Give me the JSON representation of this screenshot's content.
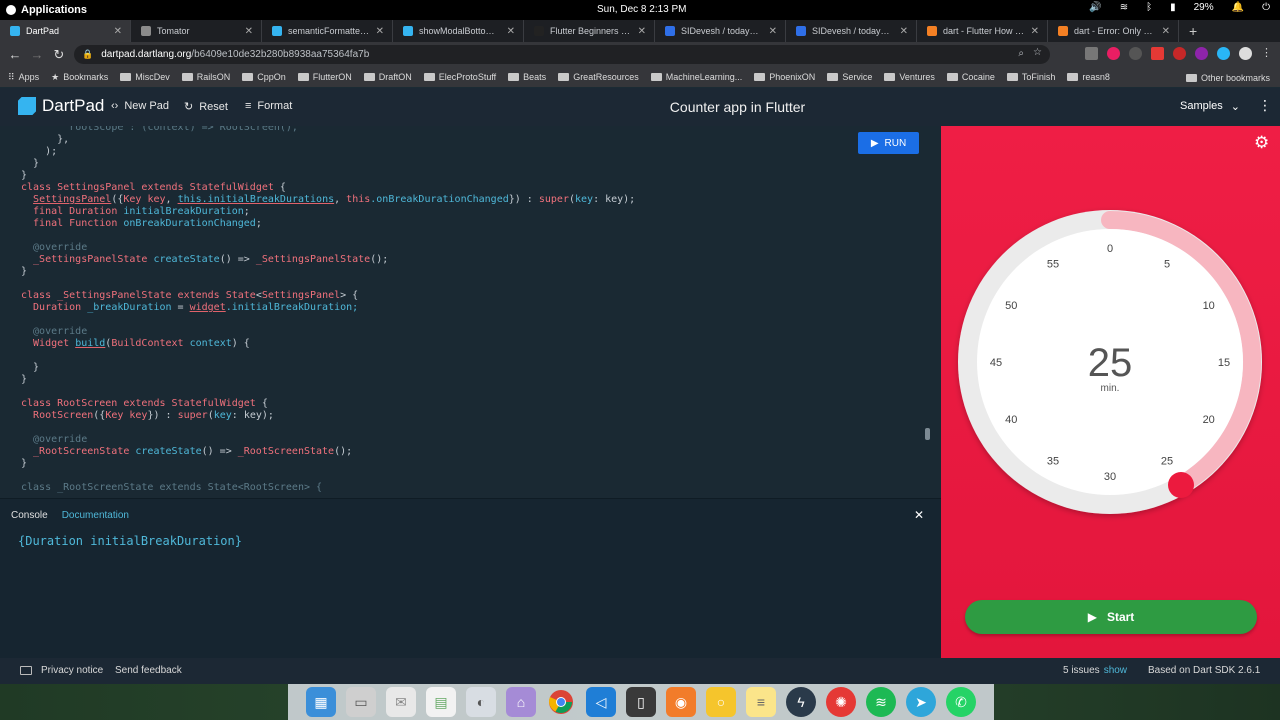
{
  "os": {
    "apps_label": "Applications",
    "clock": "Sun, Dec 8    2:13 PM",
    "battery": "29%"
  },
  "browser": {
    "tabs": [
      {
        "title": "DartPad",
        "color": "#35b4f0"
      },
      {
        "title": "Tomator",
        "color": "#8b8b8b"
      },
      {
        "title": "semanticFormatterCall",
        "color": "#35b4f0"
      },
      {
        "title": "showModalBottomShe",
        "color": "#35b4f0"
      },
      {
        "title": "Flutter Beginners Guide",
        "color": "#222222"
      },
      {
        "title": "SIDevesh / today_in_life",
        "color": "#2f6fe8"
      },
      {
        "title": "SIDevesh / today_in_life",
        "color": "#2f6fe8"
      },
      {
        "title": "dart - Flutter How to se",
        "color": "#f48024"
      },
      {
        "title": "dart - Error: Only static",
        "color": "#f48024"
      }
    ],
    "url_host": "dartpad.dartlang.org",
    "url_path": "/b6409e10de32b280b8938aa75364fa7b",
    "bookmarks": [
      {
        "label": "Apps",
        "kind": "apps"
      },
      {
        "label": "Bookmarks",
        "kind": "star"
      },
      {
        "label": "MiscDev",
        "kind": "folder"
      },
      {
        "label": "RailsON",
        "kind": "folder"
      },
      {
        "label": "CppOn",
        "kind": "folder"
      },
      {
        "label": "FlutterON",
        "kind": "folder"
      },
      {
        "label": "DraftON",
        "kind": "folder"
      },
      {
        "label": "ElecProtoStuff",
        "kind": "folder"
      },
      {
        "label": "Beats",
        "kind": "folder"
      },
      {
        "label": "GreatResources",
        "kind": "folder"
      },
      {
        "label": "MachineLearning...",
        "kind": "folder"
      },
      {
        "label": "PhoenixON",
        "kind": "folder"
      },
      {
        "label": "Service",
        "kind": "folder"
      },
      {
        "label": "Ventures",
        "kind": "folder"
      },
      {
        "label": "Cocaine",
        "kind": "folder"
      },
      {
        "label": "ToFinish",
        "kind": "folder"
      },
      {
        "label": "reasn8",
        "kind": "folder"
      }
    ],
    "other_bookmarks": "Other bookmarks"
  },
  "dartpad": {
    "logo": "DartPad",
    "new_pad": "New Pad",
    "reset": "Reset",
    "format": "Format",
    "title": "Counter app in Flutter",
    "samples": "Samples",
    "run": "RUN",
    "console_tab": "Console",
    "documentation_tab": "Documentation",
    "console_output": "{Duration initialBreakDuration}",
    "privacy": "Privacy notice",
    "feedback": "Send feedback",
    "issues": "5 issues",
    "issues_show": "show",
    "sdk": "Based on Dart SDK 2.6.1"
  },
  "timer": {
    "value": "25",
    "unit": "min.",
    "start_label": "Start",
    "dial_labels": [
      "0",
      "5",
      "10",
      "15",
      "20",
      "25",
      "30",
      "35",
      "40",
      "45",
      "50",
      "55"
    ],
    "progress_fraction": 0.4167,
    "accent": "#e3163c",
    "button_color": "#2e9b42"
  },
  "code_lines": [
    [
      {
        "t": "        ",
        "c": ""
      },
      {
        "t": "rootScope : (context) => RootScreen(),",
        "c": "an"
      }
    ],
    [
      {
        "t": "      },",
        "c": ""
      }
    ],
    [
      {
        "t": "    );",
        "c": ""
      }
    ],
    [
      {
        "t": "  }",
        "c": ""
      }
    ],
    [
      {
        "t": "}",
        "c": ""
      }
    ],
    [
      {
        "t": "class ",
        "c": "kw"
      },
      {
        "t": "SettingsPanel ",
        "c": "ty"
      },
      {
        "t": "extends ",
        "c": "kw"
      },
      {
        "t": "StatefulWidget",
        "c": "ty"
      },
      {
        "t": " {",
        "c": ""
      }
    ],
    [
      {
        "t": "  ",
        "c": ""
      },
      {
        "t": "SettingsPanel",
        "c": "ty ul"
      },
      {
        "t": "({",
        "c": ""
      },
      {
        "t": "Key key",
        "c": "ty"
      },
      {
        "t": ", ",
        "c": ""
      },
      {
        "t": "this.initialBreakDurations",
        "c": "id ul"
      },
      {
        "t": ", ",
        "c": ""
      },
      {
        "t": "this",
        "c": "kw"
      },
      {
        "t": ".onBreakDurationChanged",
        "c": "id"
      },
      {
        "t": "}) : ",
        "c": ""
      },
      {
        "t": "super",
        "c": "kw"
      },
      {
        "t": "(",
        "c": ""
      },
      {
        "t": "key",
        "c": "id"
      },
      {
        "t": ": key);",
        "c": ""
      }
    ],
    [
      {
        "t": "  final ",
        "c": "kw"
      },
      {
        "t": "Duration ",
        "c": "ty"
      },
      {
        "t": "initialBreakDuration",
        "c": "id"
      },
      {
        "t": ";",
        "c": ""
      }
    ],
    [
      {
        "t": "  final ",
        "c": "kw"
      },
      {
        "t": "Function ",
        "c": "ty"
      },
      {
        "t": "onBreakDurationChanged",
        "c": "id"
      },
      {
        "t": ";",
        "c": ""
      }
    ],
    [
      {
        "t": "",
        "c": ""
      }
    ],
    [
      {
        "t": "  @override",
        "c": "an"
      }
    ],
    [
      {
        "t": "  _SettingsPanelState ",
        "c": "ty"
      },
      {
        "t": "createState",
        "c": "fn"
      },
      {
        "t": "() => ",
        "c": ""
      },
      {
        "t": "_SettingsPanelState",
        "c": "ty"
      },
      {
        "t": "();",
        "c": ""
      }
    ],
    [
      {
        "t": "}",
        "c": ""
      }
    ],
    [
      {
        "t": "",
        "c": ""
      }
    ],
    [
      {
        "t": "class ",
        "c": "kw"
      },
      {
        "t": "_SettingsPanelState ",
        "c": "ty"
      },
      {
        "t": "extends ",
        "c": "kw"
      },
      {
        "t": "State",
        "c": "ty"
      },
      {
        "t": "<",
        "c": ""
      },
      {
        "t": "SettingsPanel",
        "c": "ty"
      },
      {
        "t": "> {",
        "c": ""
      }
    ],
    [
      {
        "t": "  Duration ",
        "c": "ty"
      },
      {
        "t": "_breakDuration",
        "c": "id"
      },
      {
        "t": " = ",
        "c": ""
      },
      {
        "t": "widget",
        "c": "kw ul"
      },
      {
        "t": ".initialBreakDuration;",
        "c": "id"
      }
    ],
    [
      {
        "t": "",
        "c": ""
      }
    ],
    [
      {
        "t": "  @override",
        "c": "an"
      }
    ],
    [
      {
        "t": "  Widget ",
        "c": "ty"
      },
      {
        "t": "build",
        "c": "fn ul"
      },
      {
        "t": "(",
        "c": ""
      },
      {
        "t": "BuildContext ",
        "c": "ty"
      },
      {
        "t": "context",
        "c": "id"
      },
      {
        "t": ") {",
        "c": ""
      }
    ],
    [
      {
        "t": "",
        "c": ""
      }
    ],
    [
      {
        "t": "  }",
        "c": ""
      }
    ],
    [
      {
        "t": "}",
        "c": ""
      }
    ],
    [
      {
        "t": "",
        "c": ""
      }
    ],
    [
      {
        "t": "class ",
        "c": "kw"
      },
      {
        "t": "RootScreen ",
        "c": "ty"
      },
      {
        "t": "extends ",
        "c": "kw"
      },
      {
        "t": "StatefulWidget",
        "c": "ty"
      },
      {
        "t": " {",
        "c": ""
      }
    ],
    [
      {
        "t": "  ",
        "c": ""
      },
      {
        "t": "RootScreen",
        "c": "ty"
      },
      {
        "t": "({",
        "c": ""
      },
      {
        "t": "Key key",
        "c": "ty"
      },
      {
        "t": "}) : ",
        "c": ""
      },
      {
        "t": "super",
        "c": "kw"
      },
      {
        "t": "(",
        "c": ""
      },
      {
        "t": "key",
        "c": "id"
      },
      {
        "t": ": key);",
        "c": ""
      }
    ],
    [
      {
        "t": "",
        "c": ""
      }
    ],
    [
      {
        "t": "  @override",
        "c": "an"
      }
    ],
    [
      {
        "t": "  _RootScreenState ",
        "c": "ty"
      },
      {
        "t": "createState",
        "c": "fn"
      },
      {
        "t": "() => ",
        "c": ""
      },
      {
        "t": "_RootScreenState",
        "c": "ty"
      },
      {
        "t": "();",
        "c": ""
      }
    ],
    [
      {
        "t": "}",
        "c": ""
      }
    ],
    [
      {
        "t": "",
        "c": ""
      }
    ],
    [
      {
        "t": "class _RootScreenState extends State<RootScreen> {",
        "c": "an"
      }
    ]
  ]
}
